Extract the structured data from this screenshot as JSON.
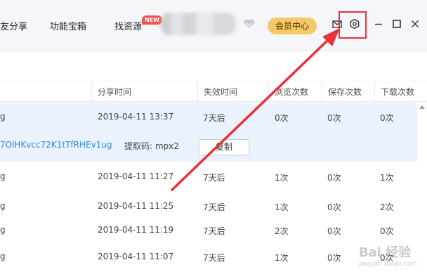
{
  "topbar": {
    "nav": [
      {
        "label": "友分享"
      },
      {
        "label": "功能宝箱"
      },
      {
        "label": "找资源"
      }
    ],
    "new_badge": "NEW",
    "vip_button": "会员中心"
  },
  "columns": [
    "分享时间",
    "失效时间",
    "浏览次数",
    "保存次数",
    "下载次数"
  ],
  "rows": [
    {
      "name": "g",
      "time": "2019-04-11 13:37",
      "expire": "7天后",
      "views": "0次",
      "saves": "0次",
      "downloads": "0次"
    },
    {
      "name": "g",
      "time": "2019-04-11 11:27",
      "expire": "7天后",
      "views": "1次",
      "saves": "0次",
      "downloads": "1次"
    },
    {
      "name": "g",
      "time": "2019-04-11 11:25",
      "expire": "7天后",
      "views": "1次",
      "saves": "0次",
      "downloads": "2次"
    },
    {
      "name": "g",
      "time": "2019-04-11 11:19",
      "expire": "7天后",
      "views": "2次",
      "saves": "0次",
      "downloads": "0次"
    },
    {
      "name": "g",
      "time": "2019-04-11 11:07",
      "expire": "7天后",
      "views": "1次",
      "saves": "0次",
      "downloads": "0次"
    }
  ],
  "share": {
    "link": "7OlHKvcc72K1tTfRHEv1ug",
    "code_label": "提取码: mpx2",
    "copy_button": "复制"
  },
  "watermark": {
    "text": "Bai 经验",
    "sub": "jingyan.baidu.com"
  },
  "colors": {
    "highlight": "#e8323c",
    "accent": "#2b89e6",
    "vip": "#f5c867"
  }
}
